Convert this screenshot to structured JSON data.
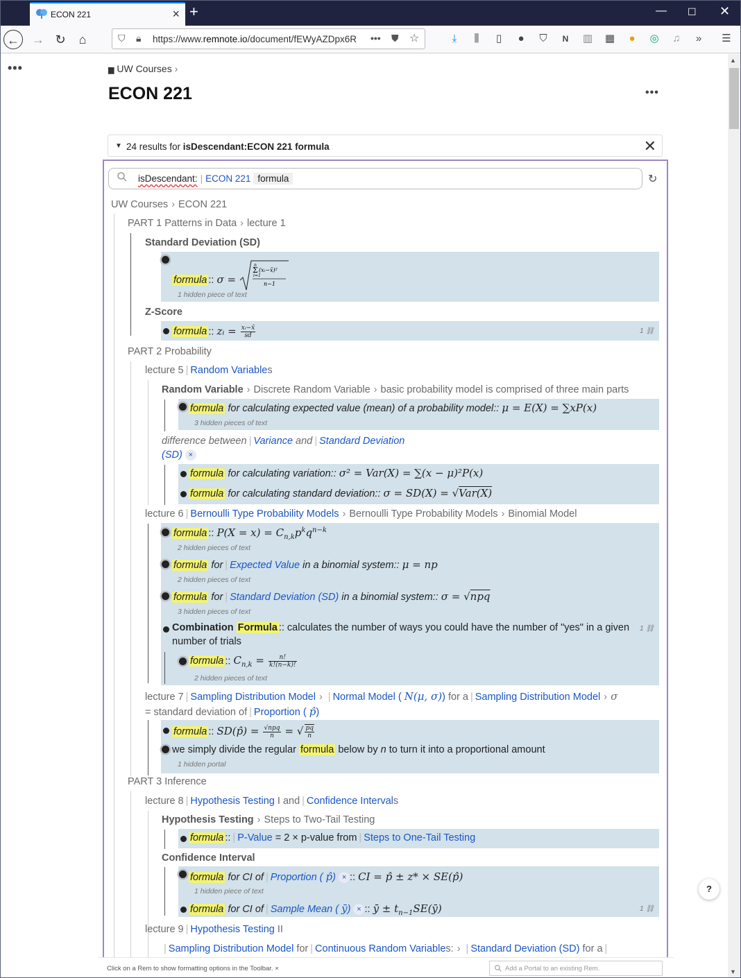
{
  "browser": {
    "tab_title": "ECON 221",
    "url_prefix": "https://www.",
    "url_domain": "remnote.io",
    "url_path": "/document/fEWyAZDpx6R"
  },
  "page": {
    "breadcrumb": "UW Courses",
    "title": "ECON 221"
  },
  "results": {
    "count_text": "24 results for ",
    "query_bold": "isDescendant:ECON 221 formula"
  },
  "search": {
    "token1": "isDescendant:",
    "token2": "ECON 221",
    "token3": "formula"
  },
  "tree": {
    "root_crumb_1": "UW Courses",
    "root_crumb_2": "ECON 221",
    "part1_a": "PART 1 Patterns in Data",
    "part1_b": "lecture 1",
    "sd_head": "Standard Deviation (SD)",
    "hidden_1": "1 hidden piece of text",
    "zscore_head": "Z-Score",
    "ref_count": "1",
    "part2": "PART 2 Probability",
    "lecture5": "lecture 5",
    "random_variable": "Random Variable",
    "s_suffix": "s",
    "rv_head": "Random Variable",
    "drv": "Discrete Random Variable",
    "basic_model": "basic probability model is comprised of three main parts",
    "formula": "formula",
    "fmean_text": " for calculating expected value (mean) of a probability model::",
    "hidden_3": "3 hidden pieces of text",
    "diff_between": "difference between",
    "variance": "Variance",
    "and": "and",
    "standard_deviation": "Standard Deviation",
    "sd_paren": "(SD)",
    "fvar_text": " for calculating variation::",
    "fsd_text": " for calculating standard deviation::",
    "lecture6": "lecture 6",
    "bernoulli": "Bernoulli Type Probability Models",
    "bernoulli2": "Bernoulli Type Probability Models",
    "binomial": "Binomial Model",
    "hidden_2": "2 hidden pieces of text",
    "for_word": "for",
    "expected_value": "Expected Value",
    "in_binomial": " in a binomial system::",
    "sd_full": "Standard Deviation (SD)",
    "combination": "Combination ",
    "combination_formula": "Formula",
    "combination_text": ":: calculates the number of ways you could have the number of \"yes\" in a given",
    "number_of_trials": "number of trials",
    "lecture7": "lecture 7",
    "sampling_dist": "Sampling Distribution Model",
    "normal_model": "Normal Model (",
    "for_a": "for a",
    "sigma_text": "= standard deviation of",
    "proportion": "Proportion (",
    "divide_text_1": "we simply divide the regular ",
    "divide_text_2": " below by ",
    "divide_n": "n",
    "divide_text_3": " to turn it into a proportional amount",
    "hidden_portal": "1 hidden portal",
    "part3": "PART 3 Inference",
    "lecture8": "lecture 8",
    "hyp_testing": "Hypothesis Testing",
    "hyp_suffix": " I",
    "conf_intervals": "Confidence Interval",
    "ht_head": "Hypothesis Testing",
    "steps_two": "Steps to Two-Tail Testing",
    "pvalue": "P-Value",
    "pvalue_text": " = 2 × p-value from",
    "steps_one": "Steps to One-Tail Testing",
    "ci_head": "Confidence Interval",
    "for_ci": " for CI of",
    "sample_mean": "Sample Mean (",
    "lecture9": "lecture 9",
    "hyp_testing2": "Hypothesis Testing",
    "ii": " II",
    "sampling_dist2": "Sampling Distribution Model",
    "cont_rv": "Continuous Random Variable",
    "s_colon": "s:",
    "sd_full2": "Standard Deviation (SD)",
    "for_a2": "for a"
  },
  "status": {
    "message": "Click on a Rem to show formatting options in the Toolbar.",
    "portal_placeholder": "Add a Portal to an existing Rem."
  },
  "help_label": "?",
  "colors": {
    "accent_link": "#1a56c4",
    "highlight": "#f3f370",
    "result_box": "#d2e1ea",
    "panel_border": "#9b88c4",
    "titlebar": "#202340"
  }
}
